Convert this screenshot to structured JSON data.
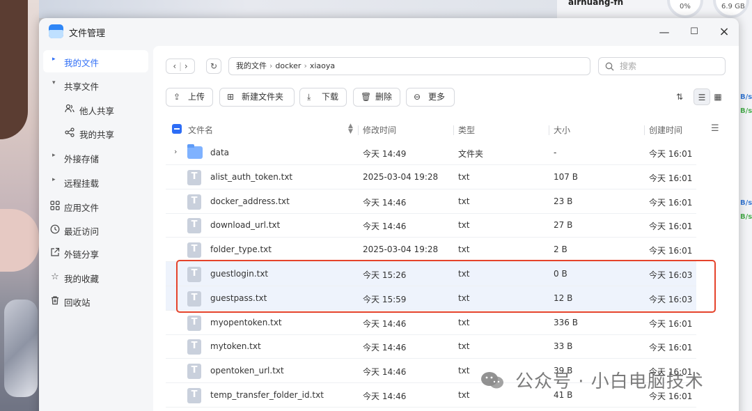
{
  "background": {
    "widget_name": "airhuang-fn",
    "gauge_cpu": "0%",
    "gauge_mem": "6.9 GB",
    "edge_labels": [
      "B/s",
      "B/s",
      "B/s",
      "B/s"
    ]
  },
  "window": {
    "title": "文件管理",
    "controls": {
      "close": "×",
      "maximize": "☐",
      "minimize": "—"
    }
  },
  "sidebar": {
    "items": [
      {
        "label": "我的文件",
        "icon": "chevron-right-icon",
        "active": true
      },
      {
        "label": "共享文件",
        "icon": "chevron-down-icon"
      },
      {
        "label": "他人共享",
        "icon": "users-icon",
        "sub": true
      },
      {
        "label": "我的共享",
        "icon": "share-icon",
        "sub": true
      },
      {
        "label": "外接存储",
        "icon": "chevron-right-icon"
      },
      {
        "label": "远程挂载",
        "icon": "chevron-right-icon"
      },
      {
        "label": "应用文件",
        "icon": "apps-icon"
      },
      {
        "label": "最近访问",
        "icon": "clock-icon"
      },
      {
        "label": "外链分享",
        "icon": "external-link-icon"
      },
      {
        "label": "我的收藏",
        "icon": "star-icon"
      },
      {
        "label": "回收站",
        "icon": "trash-icon"
      }
    ]
  },
  "breadcrumb": [
    "我的文件",
    "docker",
    "xiaoya"
  ],
  "search": {
    "placeholder": "搜索"
  },
  "toolbar": {
    "upload": "上传",
    "new_folder": "新建文件夹",
    "download": "下载",
    "delete": "删除",
    "more": "更多"
  },
  "table": {
    "columns": {
      "name": "文件名",
      "modified": "修改时间",
      "type": "类型",
      "size": "大小",
      "created": "创建时间"
    },
    "rows": [
      {
        "name": "data",
        "modified": "今天 14:49",
        "type": "文件夹",
        "size": "-",
        "created": "今天 16:01",
        "kind": "folder"
      },
      {
        "name": "alist_auth_token.txt",
        "modified": "2025-03-04 19:28",
        "type": "txt",
        "size": "107 B",
        "created": "今天 16:01",
        "kind": "file"
      },
      {
        "name": "docker_address.txt",
        "modified": "今天 14:46",
        "type": "txt",
        "size": "23 B",
        "created": "今天 16:01",
        "kind": "file"
      },
      {
        "name": "download_url.txt",
        "modified": "今天 14:46",
        "type": "txt",
        "size": "27 B",
        "created": "今天 16:01",
        "kind": "file"
      },
      {
        "name": "folder_type.txt",
        "modified": "2025-03-04 19:28",
        "type": "txt",
        "size": "2 B",
        "created": "今天 16:01",
        "kind": "file"
      },
      {
        "name": "guestlogin.txt",
        "modified": "今天 15:26",
        "type": "txt",
        "size": "0 B",
        "created": "今天 16:03",
        "kind": "file",
        "selected": true
      },
      {
        "name": "guestpass.txt",
        "modified": "今天 15:59",
        "type": "txt",
        "size": "12 B",
        "created": "今天 16:03",
        "kind": "file",
        "selected": true
      },
      {
        "name": "myopentoken.txt",
        "modified": "今天 14:46",
        "type": "txt",
        "size": "336 B",
        "created": "今天 16:01",
        "kind": "file"
      },
      {
        "name": "mytoken.txt",
        "modified": "今天 14:46",
        "type": "txt",
        "size": "33 B",
        "created": "今天 16:01",
        "kind": "file"
      },
      {
        "name": "opentoken_url.txt",
        "modified": "今天 14:46",
        "type": "txt",
        "size": "39 B",
        "created": "今天 16:01",
        "kind": "file"
      },
      {
        "name": "temp_transfer_folder_id.txt",
        "modified": "今天 14:46",
        "type": "txt",
        "size": "41 B",
        "created": "今天 16:01",
        "kind": "file"
      }
    ]
  },
  "watermark": "公众号 · 小白电脑技术",
  "colors": {
    "accent": "#2d6df6",
    "highlight_border": "#e5432b",
    "selected_row": "#eef3fc"
  }
}
